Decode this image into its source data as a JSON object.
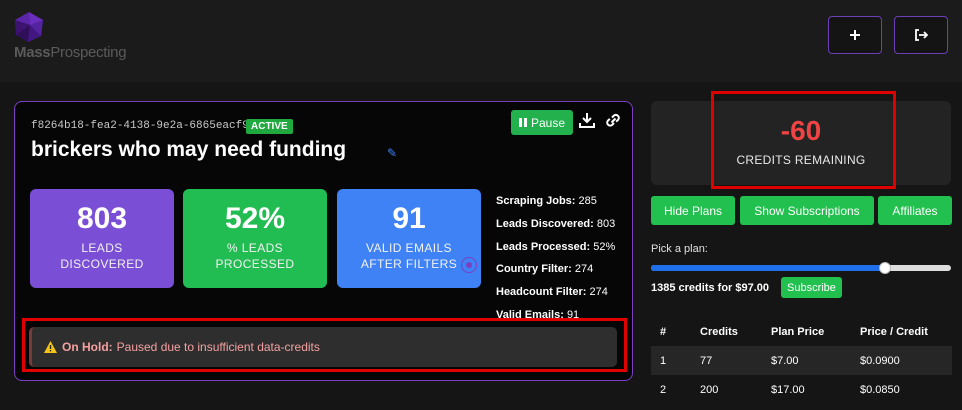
{
  "brand": {
    "name_bold": "Mass",
    "name_light": "Prospecting"
  },
  "header": {
    "add_icon": "plus-icon",
    "logout_icon": "logout-icon"
  },
  "job": {
    "id": "f8264b18-fea2-4138-9e2a-6865eacf99f5",
    "status": "ACTIVE",
    "title": "brickers who may need funding",
    "pause_label": "Pause"
  },
  "stats": [
    {
      "value": "803",
      "line1": "LEADS",
      "line2": "DISCOVERED"
    },
    {
      "value": "52%",
      "line1": "% LEADS",
      "line2": "PROCESSED"
    },
    {
      "value": "91",
      "line1": "VALID EMAILS",
      "line2": "AFTER FILTERS"
    }
  ],
  "details": [
    {
      "label": "Scraping Jobs:",
      "value": "285"
    },
    {
      "label": "Leads Discovered:",
      "value": "803"
    },
    {
      "label": "Leads Processed:",
      "value": "52%"
    },
    {
      "label": "Country Filter:",
      "value": "274"
    },
    {
      "label": "Headcount Filter:",
      "value": "274"
    },
    {
      "label": "Valid Emails:",
      "value": "91"
    }
  ],
  "hold": {
    "label": "On Hold:",
    "message": "Paused due to insufficient data-credits"
  },
  "credits": {
    "value": "-60",
    "label": "CREDITS REMAINING"
  },
  "plan_buttons": {
    "hide": "Hide Plans",
    "show": "Show Subscriptions",
    "affiliates": "Affiliates"
  },
  "plan_picker": {
    "label": "Pick a plan:",
    "slider_fraction": 0.79,
    "selected_text": "1385 credits for $97.00",
    "subscribe_label": "Subscribe"
  },
  "plans_table": {
    "headers": [
      "#",
      "Credits",
      "Plan Price",
      "Price / Credit"
    ],
    "rows": [
      [
        "1",
        "77",
        "$7.00",
        "$0.0900"
      ],
      [
        "2",
        "200",
        "$17.00",
        "$0.0850"
      ]
    ]
  },
  "colors": {
    "accent_purple": "#7b3fc0",
    "green": "#22c04e",
    "blue": "#3e82f5",
    "danger": "#ef4444",
    "highlight_red": "#e00000"
  }
}
